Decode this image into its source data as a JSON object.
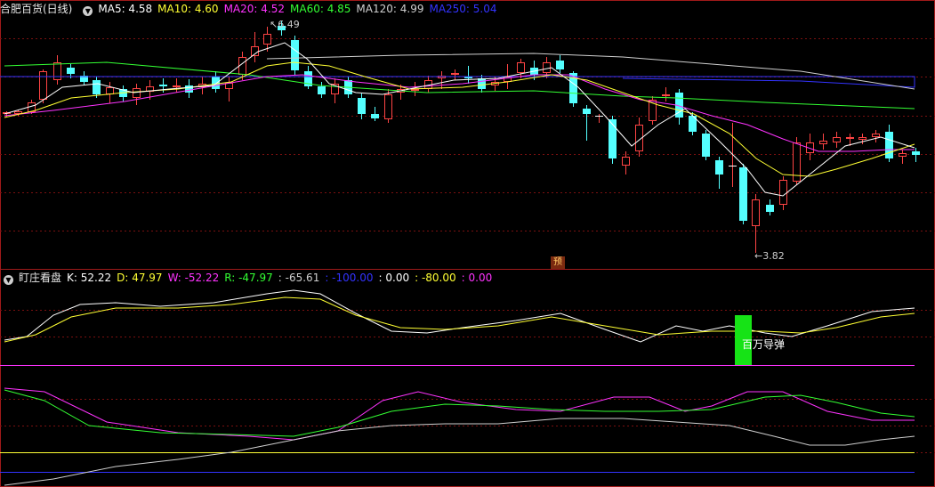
{
  "header": {
    "title": "合肥百货(日线)",
    "ma": [
      {
        "label": "MA5: 4.58",
        "color": "#ffffff"
      },
      {
        "label": "MA10: 4.60",
        "color": "#ffff33"
      },
      {
        "label": "MA20: 4.52",
        "color": "#ff33ff"
      },
      {
        "label": "MA60: 4.85",
        "color": "#33ff33"
      },
      {
        "label": "MA120: 4.99",
        "color": "#cfcfcf"
      },
      {
        "label": "MA250: 5.04",
        "color": "#3333ff"
      }
    ]
  },
  "price_labels": {
    "high": "6.49",
    "low": "3.82"
  },
  "forecast_badge": "预",
  "indicator": {
    "title": "盯庄看盘",
    "values": [
      {
        "label": "K: 52.22",
        "color": "#ffffff"
      },
      {
        "label": "D: 47.97",
        "color": "#ffff33"
      },
      {
        "label": "W: -52.22",
        "color": "#ff33ff"
      },
      {
        "label": "R: -47.97",
        "color": "#33ff33"
      },
      {
        "label": ": -65.61",
        "color": "#cfcfcf"
      },
      {
        "label": ": -100.00",
        "color": "#3333ff"
      },
      {
        "label": ": 0.00",
        "color": "#ffffff"
      },
      {
        "label": ": -80.00",
        "color": "#ffff33"
      },
      {
        "label": ": 0.00",
        "color": "#ff33ff"
      }
    ],
    "signal_text": "百万导弹"
  },
  "colors": {
    "up": "#ff4444",
    "down": "#54ffff",
    "grid": "#7a1010",
    "border": "#a01a1a",
    "ma5": "#ffffff",
    "ma10": "#ffff33",
    "ma20": "#ff33ff",
    "ma60": "#33ff33",
    "ma120": "#cfcfcf",
    "ma250": "#3333ff"
  }
}
